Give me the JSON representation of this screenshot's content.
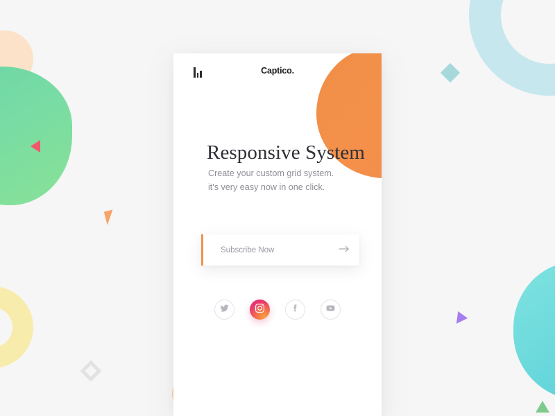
{
  "page": {
    "background_color": "#f6f6f6"
  },
  "card": {
    "header": {
      "menu_icon": "bar-menu-icon",
      "brand": "Captico."
    },
    "hero": {
      "headline": "Responsive System",
      "subcopy_line_1": "Create your custom grid system.",
      "subcopy_line_2": "it's very easy now in one click."
    },
    "subscribe": {
      "placeholder": "Subscribe Now",
      "value": "",
      "submit_icon": "arrow-right-icon",
      "accent_color": "#f2914f"
    },
    "social": [
      {
        "name": "twitter",
        "label": "Twitter",
        "active": false
      },
      {
        "name": "instagram",
        "label": "Instagram",
        "active": true
      },
      {
        "name": "facebook",
        "label": "Facebook",
        "active": false
      },
      {
        "name": "youtube",
        "label": "YouTube",
        "active": false
      }
    ],
    "decor": {
      "orange_blob_color": "#f1904a"
    }
  },
  "decorations": [
    {
      "name": "green-blob",
      "color": "#5ed4a8"
    },
    {
      "name": "peach-circle-top-left",
      "color": "#fcdec0"
    },
    {
      "name": "yellow-ring",
      "color": "#f7ecab"
    },
    {
      "name": "blue-ring",
      "color": "#c7e7ee"
    },
    {
      "name": "cyan-blob",
      "color": "#57cfd8"
    },
    {
      "name": "peach-circle-bottom",
      "color": "#f9b7b0"
    },
    {
      "name": "pink-triangle",
      "color": "#f2566b"
    },
    {
      "name": "orange-triangle",
      "color": "#f9a367"
    },
    {
      "name": "purple-triangle",
      "color": "#a57df0"
    },
    {
      "name": "green-triangle",
      "color": "#7fc98a"
    },
    {
      "name": "teal-diamond",
      "color": "#a8d9da"
    },
    {
      "name": "gray-diamond",
      "color": "#e2e2e2"
    }
  ]
}
